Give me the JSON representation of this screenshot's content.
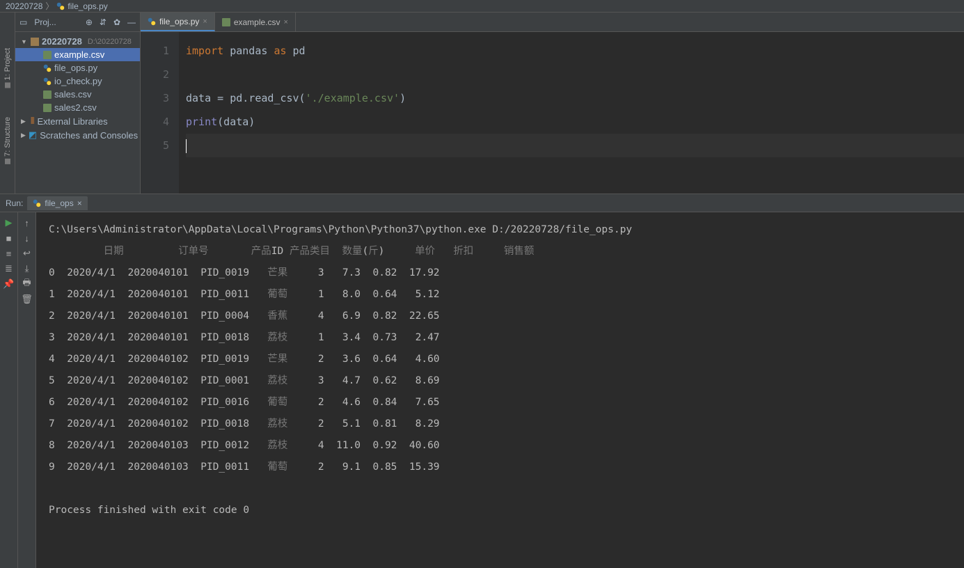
{
  "breadcrumb": {
    "folder": "20220728",
    "file": "file_ops.py"
  },
  "sidebar": {
    "title": "Proj...",
    "root": {
      "name": "20220728",
      "path": "D:\\20220728"
    },
    "files": [
      {
        "name": "example.csv",
        "selected": true,
        "type": "csv"
      },
      {
        "name": "file_ops.py",
        "type": "py"
      },
      {
        "name": "io_check.py",
        "type": "py"
      },
      {
        "name": "sales.csv",
        "type": "csv"
      },
      {
        "name": "sales2.csv",
        "type": "csv"
      }
    ],
    "ext_lib": "External Libraries",
    "scratch": "Scratches and Consoles"
  },
  "left_tabs": {
    "project": "1: Project",
    "structure": "7: Structure"
  },
  "editor": {
    "tabs": [
      {
        "name": "file_ops.py",
        "active": true,
        "type": "py"
      },
      {
        "name": "example.csv",
        "active": false,
        "type": "csv"
      }
    ],
    "line_numbers": [
      "1",
      "2",
      "3",
      "4",
      "5"
    ],
    "tokens": {
      "l1_kw1": "import",
      "l1_id": " pandas ",
      "l1_kw2": "as",
      "l1_id2": " pd",
      "l3_a": "data = pd.read_csv(",
      "l3_s": "'./example.csv'",
      "l3_b": ")",
      "l4_fn": "print",
      "l4_a": "(data)"
    }
  },
  "run": {
    "label": "Run:",
    "tab": "file_ops",
    "cmd": "C:\\Users\\Administrator\\AppData\\Local\\Programs\\Python\\Python37\\python.exe D:/20220728/file_ops.py",
    "header_row": "         日期         订单号       产品ID 产品类目  数量(斤)     单价   折扣     销售额",
    "rows": [
      "0  2020/4/1  2020040101  PID_0019   芒果     3   7.3  0.82  17.92",
      "1  2020/4/1  2020040101  PID_0011   葡萄     1   8.0  0.64   5.12",
      "2  2020/4/1  2020040101  PID_0004   香蕉     4   6.9  0.82  22.65",
      "3  2020/4/1  2020040101  PID_0018   荔枝     1   3.4  0.73   2.47",
      "4  2020/4/1  2020040102  PID_0019   芒果     2   3.6  0.64   4.60",
      "5  2020/4/1  2020040102  PID_0001   荔枝     3   4.7  0.62   8.69",
      "6  2020/4/1  2020040102  PID_0016   葡萄     2   4.6  0.84   7.65",
      "7  2020/4/1  2020040102  PID_0018   荔枝     2   5.1  0.81   8.29",
      "8  2020/4/1  2020040103  PID_0012   荔枝     4  11.0  0.92  40.60",
      "9  2020/4/1  2020040103  PID_0011   葡萄     2   9.1  0.85  15.39"
    ],
    "exit": "Process finished with exit code 0"
  },
  "chart_data": {
    "type": "table",
    "columns": [
      "日期",
      "订单号",
      "产品ID",
      "产品类目",
      "数量(斤)",
      "单价",
      "折扣",
      "销售额"
    ],
    "rows": [
      [
        "2020/4/1",
        "2020040101",
        "PID_0019",
        "芒果",
        3,
        7.3,
        0.82,
        17.92
      ],
      [
        "2020/4/1",
        "2020040101",
        "PID_0011",
        "葡萄",
        1,
        8.0,
        0.64,
        5.12
      ],
      [
        "2020/4/1",
        "2020040101",
        "PID_0004",
        "香蕉",
        4,
        6.9,
        0.82,
        22.65
      ],
      [
        "2020/4/1",
        "2020040101",
        "PID_0018",
        "荔枝",
        1,
        3.4,
        0.73,
        2.47
      ],
      [
        "2020/4/1",
        "2020040102",
        "PID_0019",
        "芒果",
        2,
        3.6,
        0.64,
        4.6
      ],
      [
        "2020/4/1",
        "2020040102",
        "PID_0001",
        "荔枝",
        3,
        4.7,
        0.62,
        8.69
      ],
      [
        "2020/4/1",
        "2020040102",
        "PID_0016",
        "葡萄",
        2,
        4.6,
        0.84,
        7.65
      ],
      [
        "2020/4/1",
        "2020040102",
        "PID_0018",
        "荔枝",
        2,
        5.1,
        0.81,
        8.29
      ],
      [
        "2020/4/1",
        "2020040103",
        "PID_0012",
        "荔枝",
        4,
        11.0,
        0.92,
        40.6
      ],
      [
        "2020/4/1",
        "2020040103",
        "PID_0011",
        "葡萄",
        2,
        9.1,
        0.85,
        15.39
      ]
    ]
  }
}
